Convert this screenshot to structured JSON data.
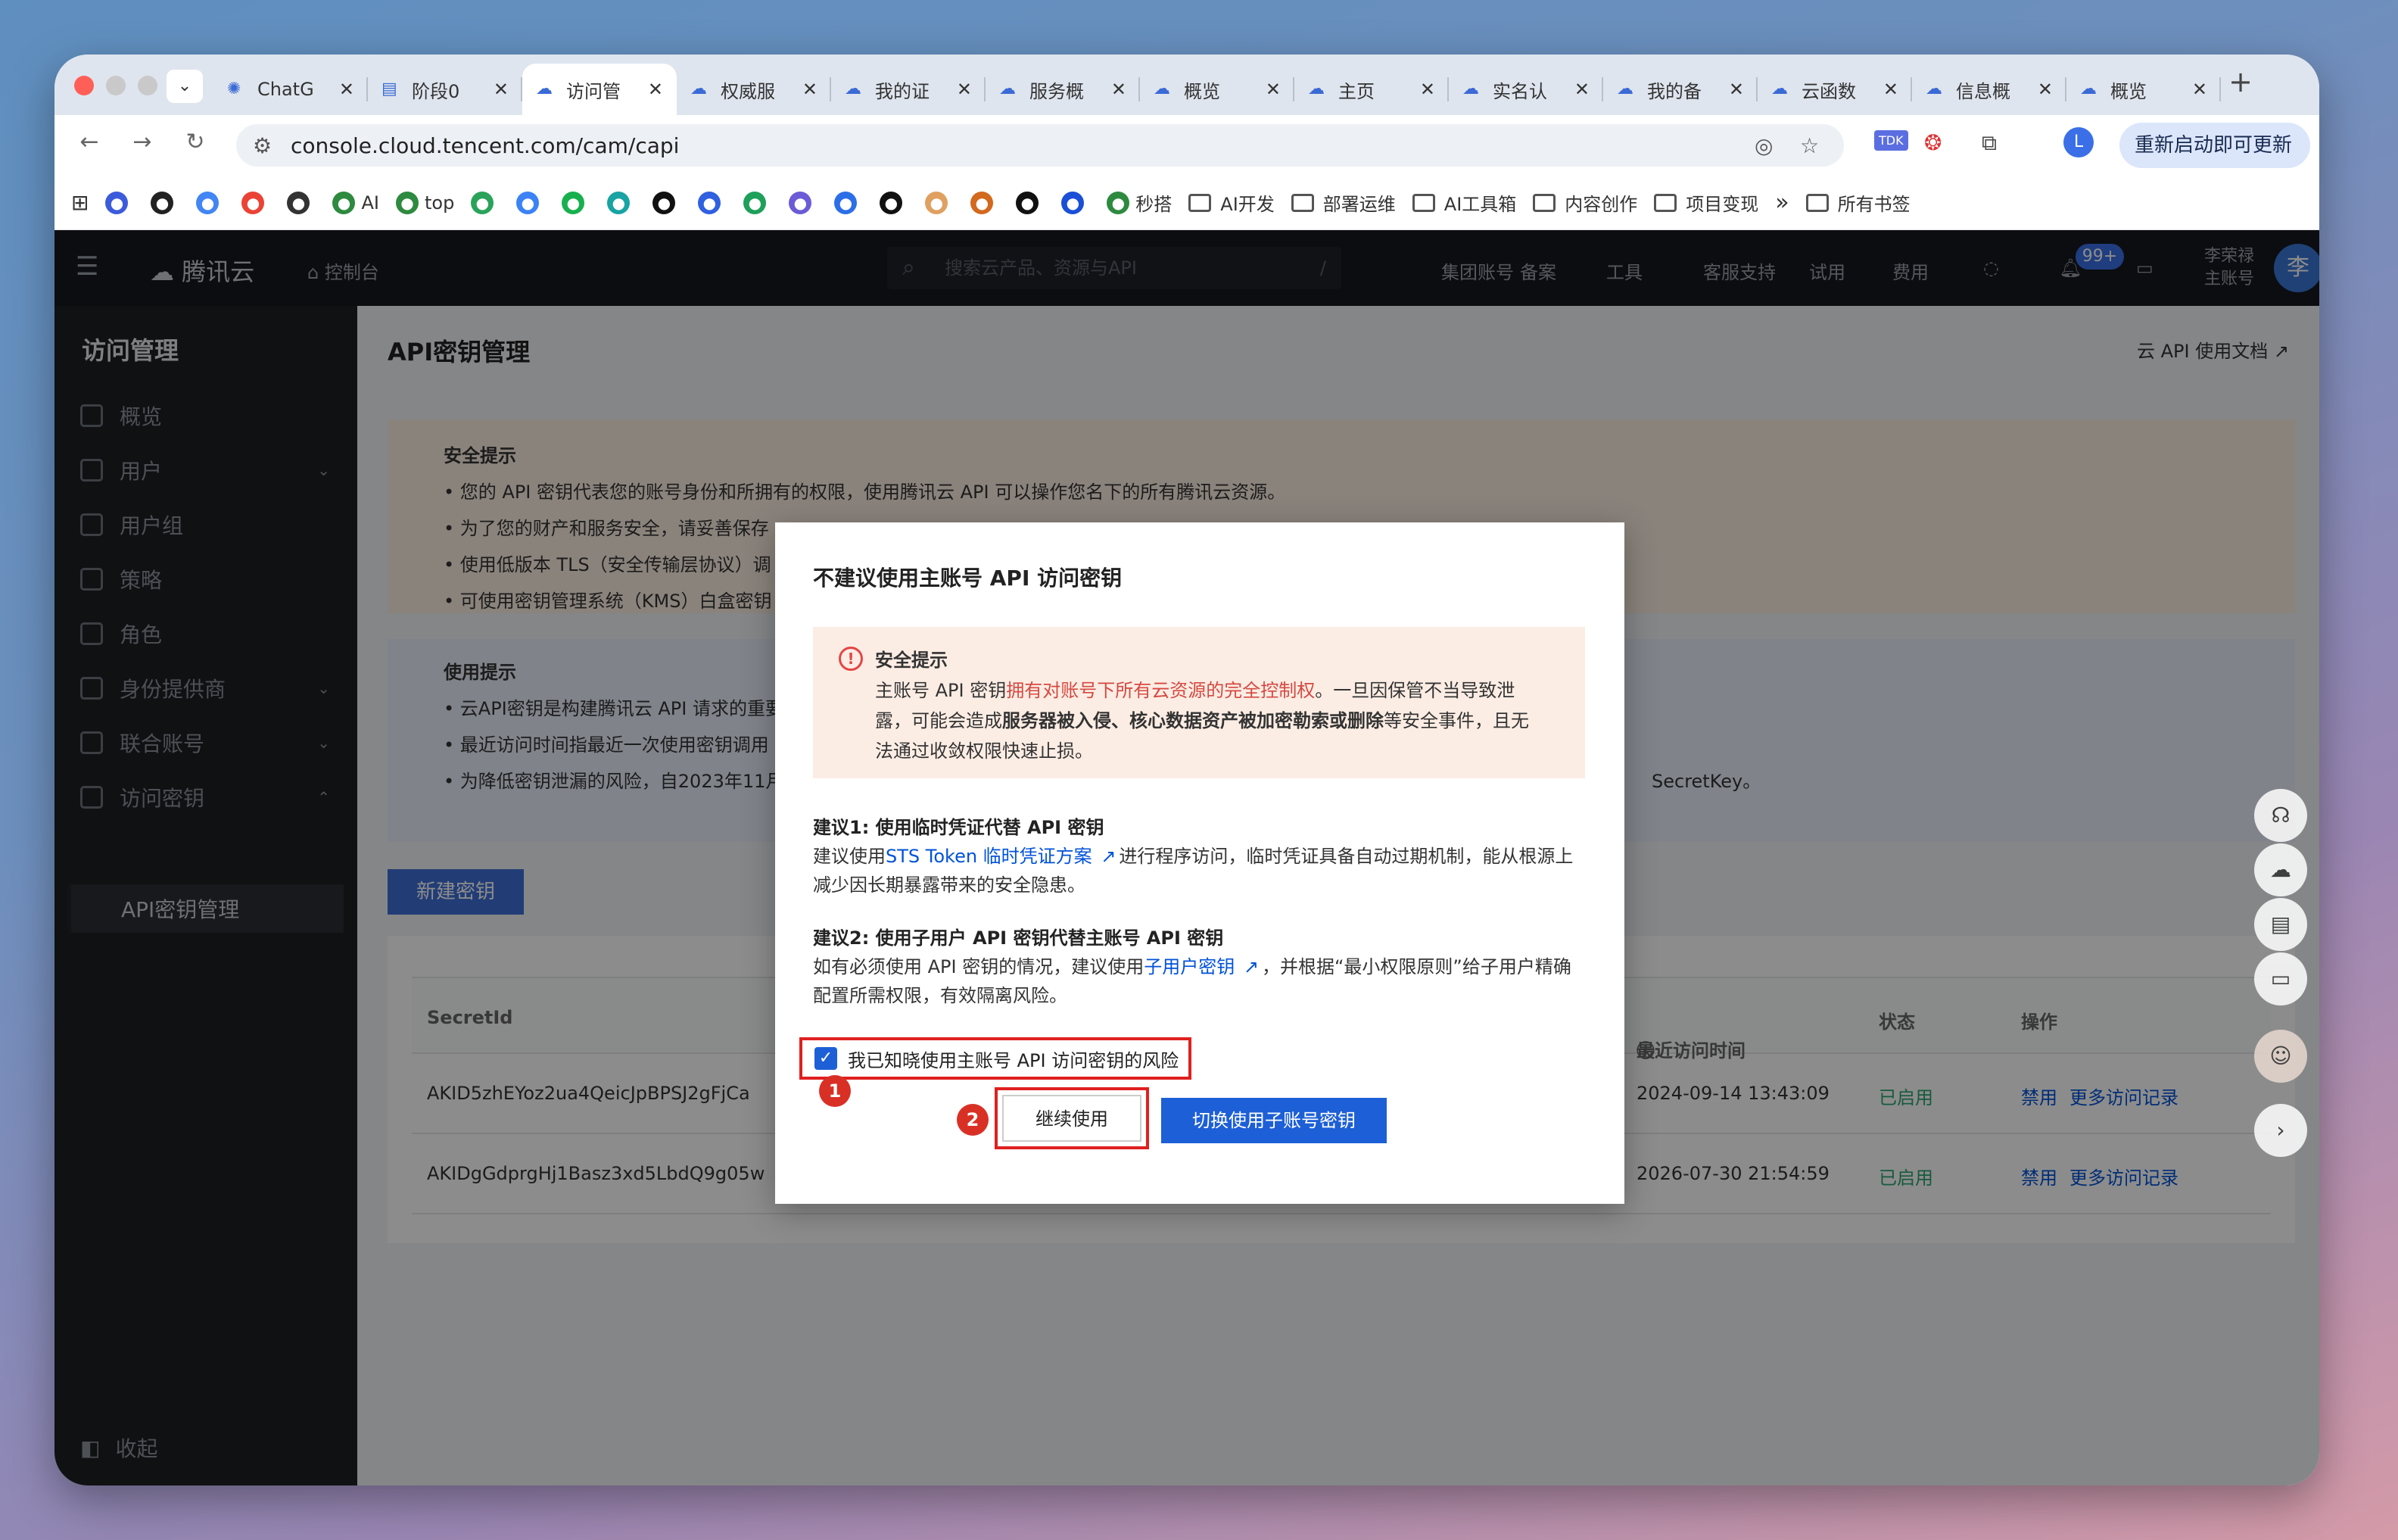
{
  "browser": {
    "tabs": [
      {
        "label": "ChatG",
        "icon": "openai-icon"
      },
      {
        "label": "阶段0",
        "icon": "doc-icon"
      },
      {
        "label": "访问管",
        "icon": "cloud-icon"
      },
      {
        "label": "权威服",
        "icon": "cloud-icon"
      },
      {
        "label": "我的证",
        "icon": "cloud-icon"
      },
      {
        "label": "服务概",
        "icon": "cloud-icon"
      },
      {
        "label": "概览",
        "icon": "cloud-icon"
      },
      {
        "label": "主页",
        "icon": "cloud-icon"
      },
      {
        "label": "实名认",
        "icon": "cloud-icon"
      },
      {
        "label": "我的备",
        "icon": "cloud-icon"
      },
      {
        "label": "云函数",
        "icon": "cloud-icon"
      },
      {
        "label": "信息概",
        "icon": "cloud-icon"
      },
      {
        "label": "概览",
        "icon": "cloud-icon"
      }
    ],
    "active_tab": 2,
    "url": "console.cloud.tencent.com/cam/capi",
    "profile_initial": "L",
    "update_label": "重新启动即可更新",
    "bookmarks": [
      {
        "label": "AI",
        "kind": "site"
      },
      {
        "label": "top",
        "kind": "site"
      },
      {
        "label": "秒搭",
        "kind": "site"
      },
      {
        "label": "AI开发",
        "kind": "folder"
      },
      {
        "label": "部署运维",
        "kind": "folder"
      },
      {
        "label": "AI工具箱",
        "kind": "folder"
      },
      {
        "label": "内容创作",
        "kind": "folder"
      },
      {
        "label": "项目变现",
        "kind": "folder"
      }
    ],
    "overflow": "»",
    "all_bookmarks": "所有书签"
  },
  "console": {
    "logo": "腾讯云",
    "home": "控制台",
    "search_placeholder": "搜索云产品、资源与API",
    "search_shortcut": "/",
    "nav": [
      "集团账号",
      "备案",
      "工具",
      "客服支持",
      "试用",
      "费用"
    ],
    "notif_badge": "99+",
    "user_name": "李荣禄",
    "user_role": "主账号",
    "user_initial": "李"
  },
  "sidebar": {
    "title": "访问管理",
    "items": [
      {
        "label": "概览",
        "caret": ""
      },
      {
        "label": "用户",
        "caret": "⌄"
      },
      {
        "label": "用户组",
        "caret": ""
      },
      {
        "label": "策略",
        "caret": ""
      },
      {
        "label": "角色",
        "caret": ""
      },
      {
        "label": "身份提供商",
        "caret": "⌄"
      },
      {
        "label": "联合账号",
        "caret": "⌄"
      },
      {
        "label": "访问密钥",
        "caret": "⌃"
      }
    ],
    "sub_item": "API密钥管理",
    "collapse": "收起"
  },
  "page": {
    "title": "API密钥管理",
    "doc_link": "云 API 使用文档",
    "security": {
      "title": "安全提示",
      "lines": [
        "• 您的 API 密钥代表您的账号身份和所拥有的权限，使用腾讯云 API 可以操作您名下的所有腾讯云资源。",
        "• 为了您的财产和服务安全，请妥善保存",
        "• 使用低版本 TLS（安全传输层协议）调",
        "• 可使用密钥管理系统（KMS）白盒密钥"
      ]
    },
    "usage": {
      "title": "使用提示",
      "lines": [
        "• 云API密钥是构建腾讯云 API 请求的重要",
        "• 最近访问时间指最近一次使用密钥调用",
        "• 为降低密钥泄漏的风险，自2023年11月"
      ],
      "tail": "SecretKey。"
    },
    "new_key": "新建密钥",
    "table": {
      "headers": [
        "SecretId",
        "最近访问时间",
        "状态",
        "操作"
      ],
      "rows": [
        {
          "id": "AKID5zhEYoz2ua4QeicJpBPSJ2gFjCa",
          "time": "2024-09-14 13:43:09",
          "status": "已启用",
          "action1": "禁用",
          "action2": "更多访问记录"
        },
        {
          "id": "AKIDgGdprgHj1Basz3xd5LbdQ9g05w",
          "time": "2026-07-30 21:54:59",
          "status": "已启用",
          "action1": "禁用",
          "action2": "更多访问记录"
        }
      ]
    }
  },
  "modal": {
    "title": "不建议使用主账号 API 访问密钥",
    "warn_title": "安全提示",
    "warn_line1_a": "主账号 API 密钥",
    "warn_line1_red": "拥有对账号下所有云资源的完全控制权",
    "warn_line1_b": "。一旦因保管不当导致泄",
    "warn_line2_a": "露，可能会造成",
    "warn_line2_bold": "服务器被入侵、核心数据资产被加密勒索或删除",
    "warn_line2_b": "等安全事件，且无",
    "warn_line3": "法通过收敛权限快速止损。",
    "s1_title": "建议1: 使用临时凭证代替 API 密钥",
    "s1_a": "建议使用",
    "s1_link": "STS Token 临时凭证方案",
    "s1_b": "进行程序访问，临时凭证具备自动过期机制，能从根源上",
    "s1_c": "减少因长期暴露带来的安全隐患。",
    "s2_title": "建议2: 使用子用户 API 密钥代替主账号 API 密钥",
    "s2_a": "如有必须使用 API 密钥的情况，建议使用",
    "s2_link": "子用户密钥",
    "s2_b": "，并根据“最小权限原则”给子用户精确",
    "s2_c": "配置所需权限，有效隔离风险。",
    "checkbox_label": "我已知晓使用主账号 API 访问密钥的风险",
    "checked": true,
    "continue": "继续使用",
    "switch": "切换使用子账号密钥",
    "step1": "1",
    "step2": "2"
  },
  "colors": {
    "primary": "#1d5fd6",
    "annotation": "#e02020",
    "danger_text": "#d54941",
    "enabled": "#2ba471"
  }
}
